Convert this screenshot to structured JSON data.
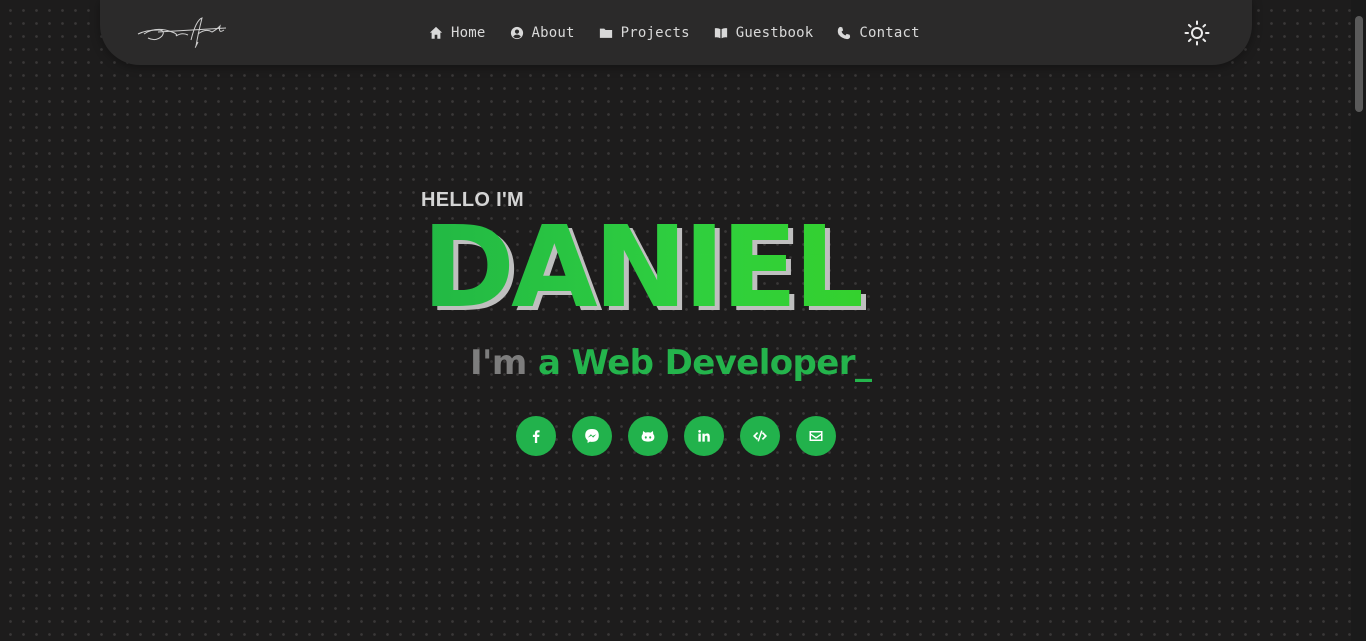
{
  "nav": {
    "logo": {
      "icon": "signature-logo"
    },
    "items": [
      {
        "label": "Home",
        "icon": "home-icon"
      },
      {
        "label": "About",
        "icon": "user-circle-icon"
      },
      {
        "label": "Projects",
        "icon": "folder-icon"
      },
      {
        "label": "Guestbook",
        "icon": "book-icon"
      },
      {
        "label": "Contact",
        "icon": "phone-icon"
      }
    ],
    "theme_toggle": {
      "icon": "sun-icon"
    }
  },
  "hero": {
    "greeting": "HELLO I'M",
    "name": "DANIEL",
    "tagline_prefix": "I'm",
    "tagline_role": "a Web Developer",
    "cursor": "_"
  },
  "socials": [
    {
      "icon": "facebook-icon"
    },
    {
      "icon": "messenger-icon"
    },
    {
      "icon": "github-icon"
    },
    {
      "icon": "linkedin-icon"
    },
    {
      "icon": "code-icon"
    },
    {
      "icon": "email-icon"
    }
  ],
  "colors": {
    "accent": "#22b24c",
    "background": "#1d1c1c",
    "navbar": "#2b2a2a",
    "muted_text": "#7d7d7d"
  }
}
